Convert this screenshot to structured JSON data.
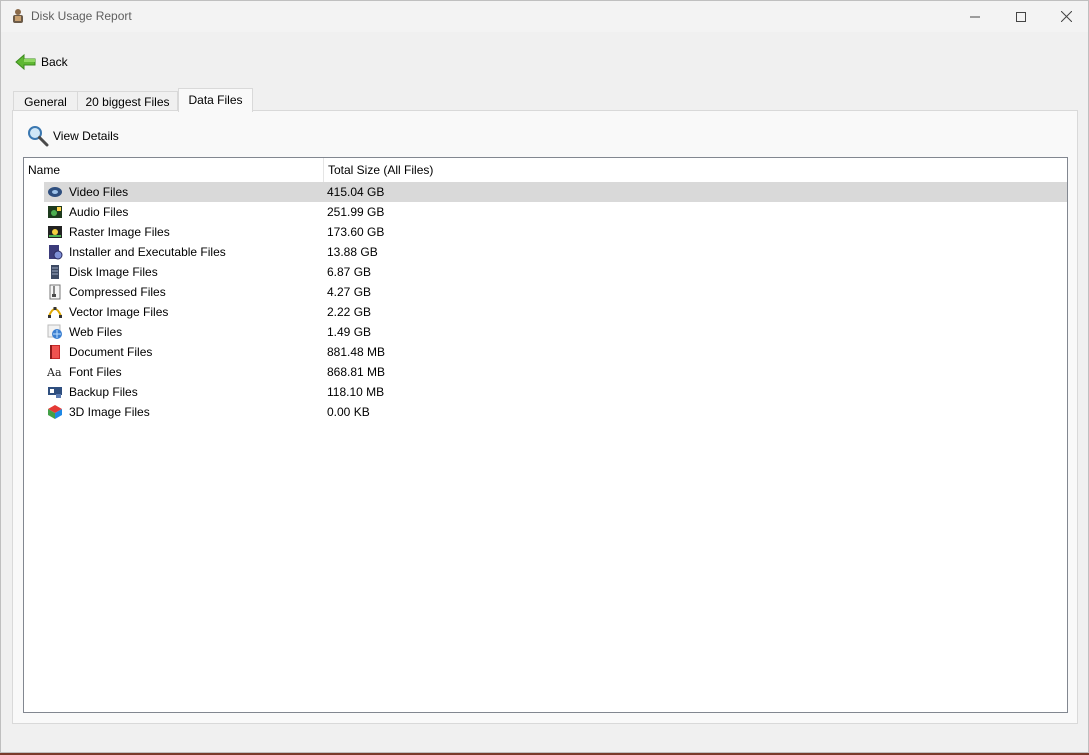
{
  "window": {
    "title": "Disk Usage Report"
  },
  "toolbar": {
    "back_label": "Back"
  },
  "tabs": [
    {
      "label": "General"
    },
    {
      "label": "20 biggest Files"
    },
    {
      "label": "Data Files"
    }
  ],
  "active_tab": "Data Files",
  "actions": {
    "view_details_label": "View Details"
  },
  "list": {
    "columns": [
      "Name",
      "Total Size (All Files)"
    ],
    "rows": [
      {
        "name": "Video Files",
        "size": "415.04 GB",
        "icon": "video-icon"
      },
      {
        "name": "Audio Files",
        "size": "251.99 GB",
        "icon": "audio-icon"
      },
      {
        "name": "Raster Image Files",
        "size": "173.60 GB",
        "icon": "raster-image-icon"
      },
      {
        "name": "Installer and Executable Files",
        "size": "13.88 GB",
        "icon": "installer-icon"
      },
      {
        "name": "Disk Image Files",
        "size": "6.87 GB",
        "icon": "disk-image-icon"
      },
      {
        "name": "Compressed Files",
        "size": "4.27 GB",
        "icon": "compressed-icon"
      },
      {
        "name": "Vector Image Files",
        "size": "2.22 GB",
        "icon": "vector-image-icon"
      },
      {
        "name": "Web Files",
        "size": "1.49 GB",
        "icon": "web-icon"
      },
      {
        "name": "Document Files",
        "size": "881.48 MB",
        "icon": "document-icon"
      },
      {
        "name": "Font Files",
        "size": "868.81 MB",
        "icon": "font-icon"
      },
      {
        "name": "Backup Files",
        "size": "118.10 MB",
        "icon": "backup-icon"
      },
      {
        "name": "3D Image Files",
        "size": "0.00 KB",
        "icon": "3d-image-icon"
      }
    ]
  },
  "colors": {
    "selection": "#d9d9d9",
    "background": "#f0f0f0",
    "list_border": "#828790"
  }
}
